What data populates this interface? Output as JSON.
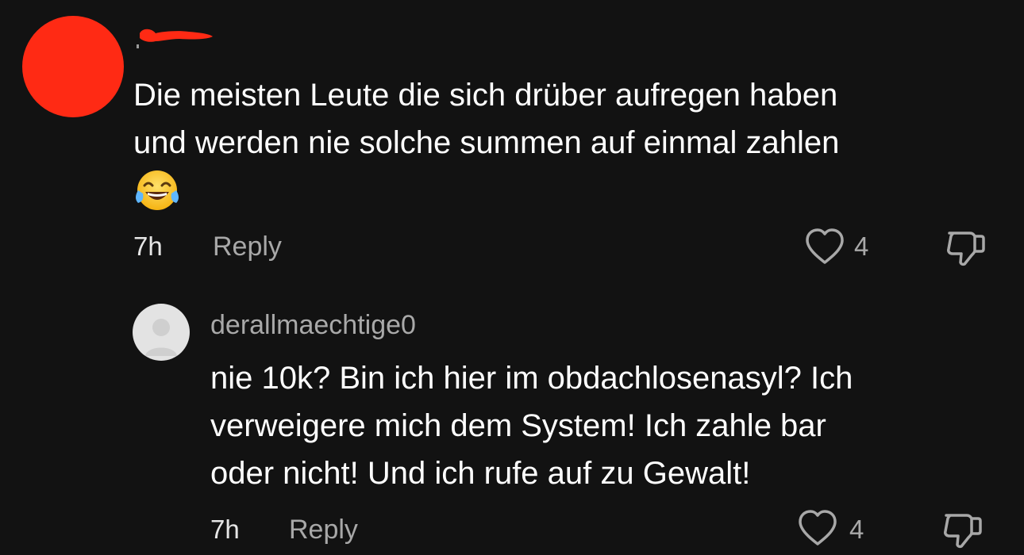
{
  "comments": [
    {
      "username": "",
      "text": "Die meisten Leute die sich drüber aufregen haben\nund werden nie solche summen auf einmal zahlen",
      "emoji": "😂",
      "time": "7h",
      "reply_label": "Reply",
      "likes": "4",
      "avatar_color": "#ff2a14"
    },
    {
      "username": "derallmaechtige0",
      "text": "nie 10k? Bin ich hier im obdachlosenasyl? Ich\nverweigere mich dem System! Ich zahle bar\noder nicht! Und ich rufe auf zu Gewalt!",
      "time": "7h",
      "reply_label": "Reply",
      "likes": "4"
    }
  ],
  "icons": {
    "like": "heart-outline-icon",
    "dislike": "thumbs-down-outline-icon",
    "emoji": "face-with-tears-of-joy"
  },
  "colors": {
    "background": "#121212",
    "text": "#ffffff",
    "muted": "#a8a8a8",
    "redaction": "#ff2a14"
  }
}
